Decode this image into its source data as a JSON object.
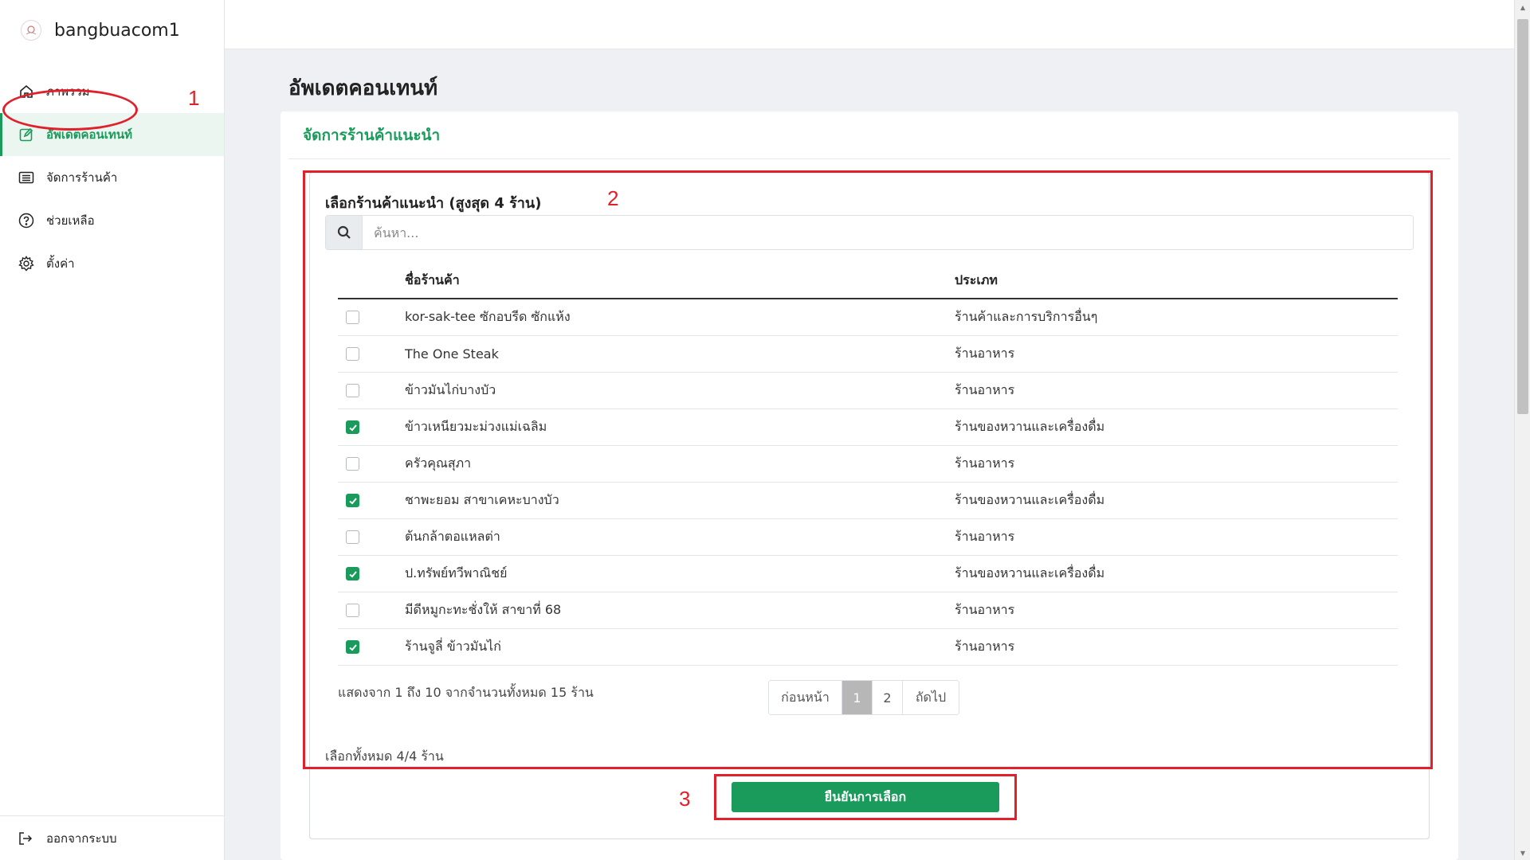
{
  "brand": {
    "name": "bangbuacom1"
  },
  "sidebar": {
    "items": [
      {
        "label": "ภาพรวม",
        "icon": "home-icon",
        "active": false
      },
      {
        "label": "อัพเดตคอนเทนท์",
        "icon": "edit-icon",
        "active": true
      },
      {
        "label": "จัดการร้านค้า",
        "icon": "list-icon",
        "active": false
      },
      {
        "label": "ช่วยเหลือ",
        "icon": "help-icon",
        "active": false
      },
      {
        "label": "ตั้งค่า",
        "icon": "gear-icon",
        "active": false
      }
    ],
    "logout_label": "ออกจากระบบ"
  },
  "page": {
    "title": "อัพเดตคอนเทนท์",
    "card_title": "จัดการร้านค้าแนะนำ",
    "section_title": "เลือกร้านค้าแนะนำ (สูงสุด 4 ร้าน)",
    "search_placeholder": "ค้นหา..."
  },
  "table": {
    "headers": {
      "name": "ชื่อร้านค้า",
      "type": "ประเภท"
    },
    "rows": [
      {
        "name": "kor-sak-tee ซักอบรีด ซักแห้ง",
        "type": "ร้านค้าและการบริการอื่นๆ",
        "checked": false
      },
      {
        "name": "The One Steak",
        "type": "ร้านอาหาร",
        "checked": false
      },
      {
        "name": "ข้าวมันไก่บางบัว",
        "type": "ร้านอาหาร",
        "checked": false
      },
      {
        "name": "ข้าวเหนียวมะม่วงแม่เฉลิม",
        "type": "ร้านของหวานและเครื่องดื่ม",
        "checked": true
      },
      {
        "name": "ครัวคุณสุภา",
        "type": "ร้านอาหาร",
        "checked": false
      },
      {
        "name": "ชาพะยอม สาขาเคหะบางบัว",
        "type": "ร้านของหวานและเครื่องดื่ม",
        "checked": true
      },
      {
        "name": "ต้นกล้าตอแหลต่า",
        "type": "ร้านอาหาร",
        "checked": false
      },
      {
        "name": "ป.ทรัพย์ทวีพาณิชย์",
        "type": "ร้านของหวานและเครื่องดื่ม",
        "checked": true
      },
      {
        "name": "มีดีหมูกะทะชั่งให้ สาขาที่ 68",
        "type": "ร้านอาหาร",
        "checked": false
      },
      {
        "name": "ร้านจูลี่ ข้าวมันไก่",
        "type": "ร้านอาหาร",
        "checked": true
      }
    ]
  },
  "pagination": {
    "info": "แสดงจาก 1 ถึง 10 จากจำนวนทั้งหมด 15 ร้าน",
    "prev": "ก่อนหน้า",
    "pages": [
      "1",
      "2"
    ],
    "active_page": "1",
    "next": "ถัดไป"
  },
  "selection": {
    "total": "เลือกทั้งหมด 4/4 ร้าน",
    "confirm_label": "ยืนยันการเลือก"
  },
  "annotations": {
    "step1": "1",
    "step2": "2",
    "step3": "3"
  },
  "colors": {
    "accent": "#1a9b5b",
    "annotation": "#e0202a"
  }
}
